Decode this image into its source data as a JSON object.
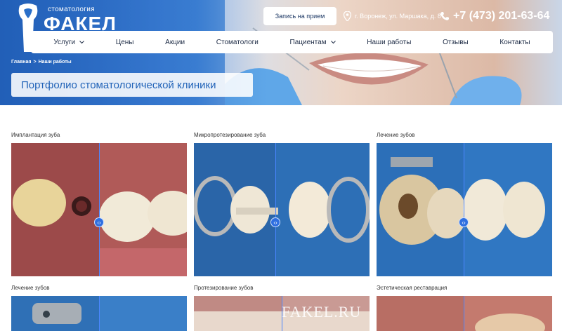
{
  "logo": {
    "subtitle": "стоматология",
    "title": "ФАКЕЛ"
  },
  "header": {
    "appointment_button": "Запись на прием",
    "address": "г. Воронеж, ул. Маршака, д. 8",
    "phone": "+7 (473) 201-63-64"
  },
  "nav": {
    "items": [
      {
        "label": "Услуги",
        "dropdown": true
      },
      {
        "label": "Цены",
        "dropdown": false
      },
      {
        "label": "Акции",
        "dropdown": false
      },
      {
        "label": "Стоматологи",
        "dropdown": false
      },
      {
        "label": "Пациентам",
        "dropdown": true
      },
      {
        "label": "Наши работы",
        "dropdown": false
      },
      {
        "label": "Отзывы",
        "dropdown": false
      },
      {
        "label": "Контакты",
        "dropdown": false
      }
    ]
  },
  "breadcrumb": {
    "home": "Главная",
    "separator": ">",
    "current": "Наши работы"
  },
  "page": {
    "title": "Портфолио стоматологической клиники"
  },
  "gallery": {
    "items": [
      {
        "label": "Имплантация зуба"
      },
      {
        "label": "Микропротезирование зуба"
      },
      {
        "label": "Лечение зубов"
      },
      {
        "label": "Лечение зубов"
      },
      {
        "label": "Протезирование зубов"
      },
      {
        "label": "Эстетическая реставрация"
      }
    ],
    "watermark": "FAKEL.RU"
  },
  "colors": {
    "brand_blue": "#2163b8",
    "nav_text": "#1d2b45",
    "slider_handle": "#2f6fe0"
  }
}
